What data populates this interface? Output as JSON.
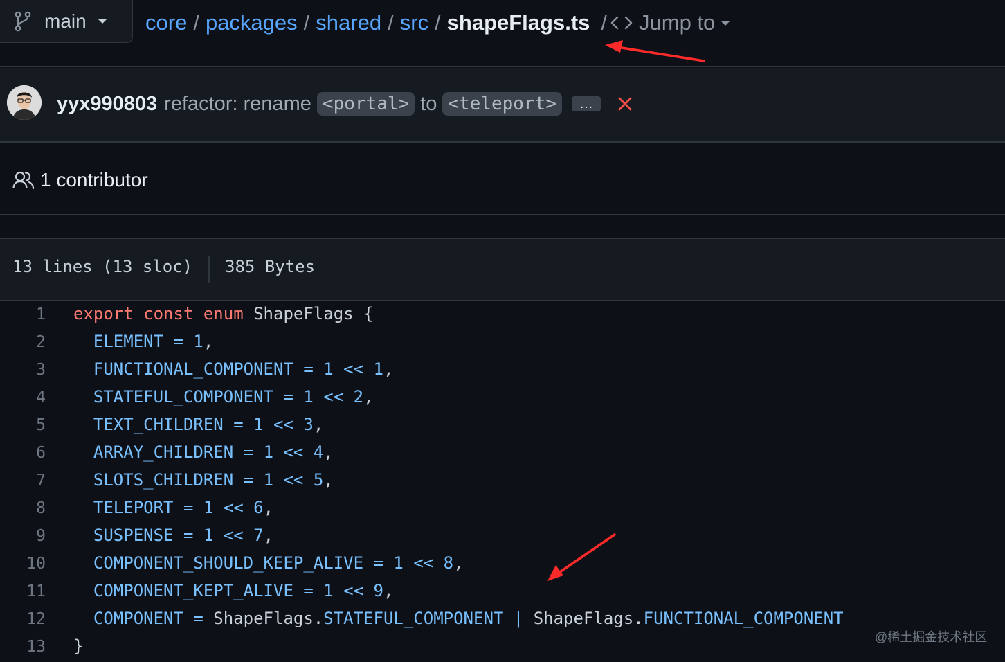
{
  "branch": {
    "name": "main",
    "icon": "git-branch-icon"
  },
  "breadcrumb": {
    "items": [
      "core",
      "packages",
      "shared",
      "src"
    ],
    "separator": "/",
    "file": "shapeFlags.ts",
    "jump_label": "Jump to"
  },
  "commit": {
    "author": "yyx990803",
    "message_prefix": "refactor: rename",
    "tag1": "<portal>",
    "message_mid": "to",
    "tag2": "<teleport>",
    "ellipsis": "…",
    "status": "failed",
    "status_color": "#f85149"
  },
  "contributors": {
    "label": "1 contributor"
  },
  "file_meta": {
    "lines": "13 lines (13 sloc)",
    "size": "385 Bytes"
  },
  "code_lines": [
    {
      "n": "1",
      "tokens": [
        {
          "t": "export",
          "c": "kw"
        },
        {
          "t": " "
        },
        {
          "t": "const",
          "c": "kw"
        },
        {
          "t": " "
        },
        {
          "t": "enum",
          "c": "kw"
        },
        {
          "t": " ShapeFlags {"
        }
      ]
    },
    {
      "n": "2",
      "tokens": [
        {
          "t": "  "
        },
        {
          "t": "ELEMENT",
          "c": "const"
        },
        {
          "t": " "
        },
        {
          "t": "=",
          "c": "const"
        },
        {
          "t": " "
        },
        {
          "t": "1",
          "c": "const"
        },
        {
          "t": ","
        }
      ]
    },
    {
      "n": "3",
      "tokens": [
        {
          "t": "  "
        },
        {
          "t": "FUNCTIONAL_COMPONENT",
          "c": "const"
        },
        {
          "t": " "
        },
        {
          "t": "=",
          "c": "const"
        },
        {
          "t": " "
        },
        {
          "t": "1",
          "c": "const"
        },
        {
          "t": " "
        },
        {
          "t": "<<",
          "c": "const"
        },
        {
          "t": " "
        },
        {
          "t": "1",
          "c": "const"
        },
        {
          "t": ","
        }
      ]
    },
    {
      "n": "4",
      "tokens": [
        {
          "t": "  "
        },
        {
          "t": "STATEFUL_COMPONENT",
          "c": "const"
        },
        {
          "t": " "
        },
        {
          "t": "=",
          "c": "const"
        },
        {
          "t": " "
        },
        {
          "t": "1",
          "c": "const"
        },
        {
          "t": " "
        },
        {
          "t": "<<",
          "c": "const"
        },
        {
          "t": " "
        },
        {
          "t": "2",
          "c": "const"
        },
        {
          "t": ","
        }
      ]
    },
    {
      "n": "5",
      "tokens": [
        {
          "t": "  "
        },
        {
          "t": "TEXT_CHILDREN",
          "c": "const"
        },
        {
          "t": " "
        },
        {
          "t": "=",
          "c": "const"
        },
        {
          "t": " "
        },
        {
          "t": "1",
          "c": "const"
        },
        {
          "t": " "
        },
        {
          "t": "<<",
          "c": "const"
        },
        {
          "t": " "
        },
        {
          "t": "3",
          "c": "const"
        },
        {
          "t": ","
        }
      ]
    },
    {
      "n": "6",
      "tokens": [
        {
          "t": "  "
        },
        {
          "t": "ARRAY_CHILDREN",
          "c": "const"
        },
        {
          "t": " "
        },
        {
          "t": "=",
          "c": "const"
        },
        {
          "t": " "
        },
        {
          "t": "1",
          "c": "const"
        },
        {
          "t": " "
        },
        {
          "t": "<<",
          "c": "const"
        },
        {
          "t": " "
        },
        {
          "t": "4",
          "c": "const"
        },
        {
          "t": ","
        }
      ]
    },
    {
      "n": "7",
      "tokens": [
        {
          "t": "  "
        },
        {
          "t": "SLOTS_CHILDREN",
          "c": "const"
        },
        {
          "t": " "
        },
        {
          "t": "=",
          "c": "const"
        },
        {
          "t": " "
        },
        {
          "t": "1",
          "c": "const"
        },
        {
          "t": " "
        },
        {
          "t": "<<",
          "c": "const"
        },
        {
          "t": " "
        },
        {
          "t": "5",
          "c": "const"
        },
        {
          "t": ","
        }
      ]
    },
    {
      "n": "8",
      "tokens": [
        {
          "t": "  "
        },
        {
          "t": "TELEPORT",
          "c": "const"
        },
        {
          "t": " "
        },
        {
          "t": "=",
          "c": "const"
        },
        {
          "t": " "
        },
        {
          "t": "1",
          "c": "const"
        },
        {
          "t": " "
        },
        {
          "t": "<<",
          "c": "const"
        },
        {
          "t": " "
        },
        {
          "t": "6",
          "c": "const"
        },
        {
          "t": ","
        }
      ]
    },
    {
      "n": "9",
      "tokens": [
        {
          "t": "  "
        },
        {
          "t": "SUSPENSE",
          "c": "const"
        },
        {
          "t": " "
        },
        {
          "t": "=",
          "c": "const"
        },
        {
          "t": " "
        },
        {
          "t": "1",
          "c": "const"
        },
        {
          "t": " "
        },
        {
          "t": "<<",
          "c": "const"
        },
        {
          "t": " "
        },
        {
          "t": "7",
          "c": "const"
        },
        {
          "t": ","
        }
      ]
    },
    {
      "n": "10",
      "tokens": [
        {
          "t": "  "
        },
        {
          "t": "COMPONENT_SHOULD_KEEP_ALIVE",
          "c": "const"
        },
        {
          "t": " "
        },
        {
          "t": "=",
          "c": "const"
        },
        {
          "t": " "
        },
        {
          "t": "1",
          "c": "const"
        },
        {
          "t": " "
        },
        {
          "t": "<<",
          "c": "const"
        },
        {
          "t": " "
        },
        {
          "t": "8",
          "c": "const"
        },
        {
          "t": ","
        }
      ]
    },
    {
      "n": "11",
      "tokens": [
        {
          "t": "  "
        },
        {
          "t": "COMPONENT_KEPT_ALIVE",
          "c": "const"
        },
        {
          "t": " "
        },
        {
          "t": "=",
          "c": "const"
        },
        {
          "t": " "
        },
        {
          "t": "1",
          "c": "const"
        },
        {
          "t": " "
        },
        {
          "t": "<<",
          "c": "const"
        },
        {
          "t": " "
        },
        {
          "t": "9",
          "c": "const"
        },
        {
          "t": ","
        }
      ]
    },
    {
      "n": "12",
      "tokens": [
        {
          "t": "  "
        },
        {
          "t": "COMPONENT",
          "c": "const"
        },
        {
          "t": " "
        },
        {
          "t": "=",
          "c": "const"
        },
        {
          "t": " ShapeFlags."
        },
        {
          "t": "STATEFUL_COMPONENT",
          "c": "const"
        },
        {
          "t": " "
        },
        {
          "t": "|",
          "c": "const"
        },
        {
          "t": " ShapeFlags."
        },
        {
          "t": "FUNCTIONAL_COMPONENT",
          "c": "const"
        }
      ]
    },
    {
      "n": "13",
      "tokens": [
        {
          "t": "}"
        }
      ]
    }
  ],
  "annotations": {
    "arrow_color": "#ff2a2a"
  },
  "watermark": "@稀土掘金技术社区",
  "colors": {
    "background": "#0d1117",
    "link": "#58a6ff",
    "keyword": "#ff7b72",
    "constant": "#79c0ff",
    "text": "#c9d1d9"
  }
}
